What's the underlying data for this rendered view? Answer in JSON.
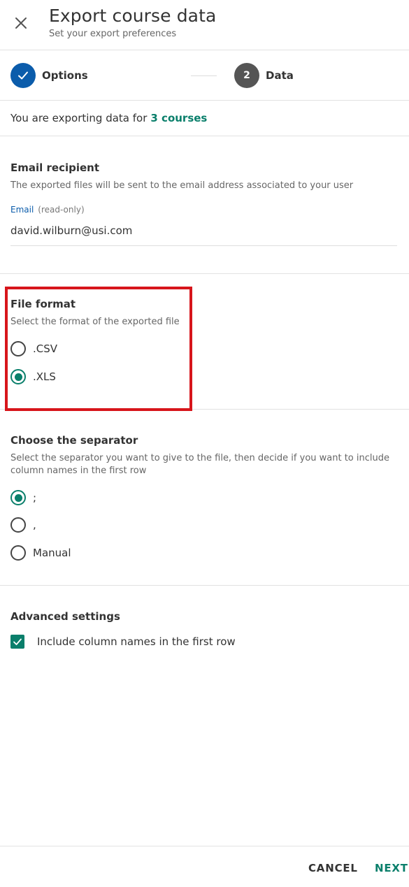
{
  "header": {
    "title": "Export course data",
    "subtitle": "Set your export preferences"
  },
  "stepper": {
    "steps": [
      {
        "label": "Options",
        "status": "done",
        "number": "1"
      },
      {
        "label": "Data",
        "status": "pending",
        "number": "2"
      }
    ]
  },
  "summary": {
    "prefix": "You are exporting data for",
    "count_text": "3 courses"
  },
  "email_section": {
    "title": "Email recipient",
    "description": "The exported files will be sent to the email address associated to your user",
    "field_label": "Email",
    "field_note": "(read-only)",
    "value": "david.wilburn@usi.com"
  },
  "format_section": {
    "title": "File format",
    "description": "Select the format of the exported file",
    "options": [
      {
        "label": ".CSV",
        "checked": false
      },
      {
        "label": ".XLS",
        "checked": true
      }
    ]
  },
  "separator_section": {
    "title": "Choose the separator",
    "description": "Select the separator you want to give to the file, then decide if you want to include column names in the first row",
    "options": [
      {
        "label": ";",
        "checked": true
      },
      {
        "label": ",",
        "checked": false
      },
      {
        "label": "Manual",
        "checked": false
      }
    ]
  },
  "advanced": {
    "title": "Advanced settings",
    "checkbox_label": "Include column names in the first row",
    "checked": true
  },
  "footer": {
    "cancel_label": "CANCEL",
    "next_label": "NEXT"
  },
  "colors": {
    "accent": "#0a7f6b",
    "step_done": "#0b5cab",
    "highlight": "#d7151b"
  }
}
